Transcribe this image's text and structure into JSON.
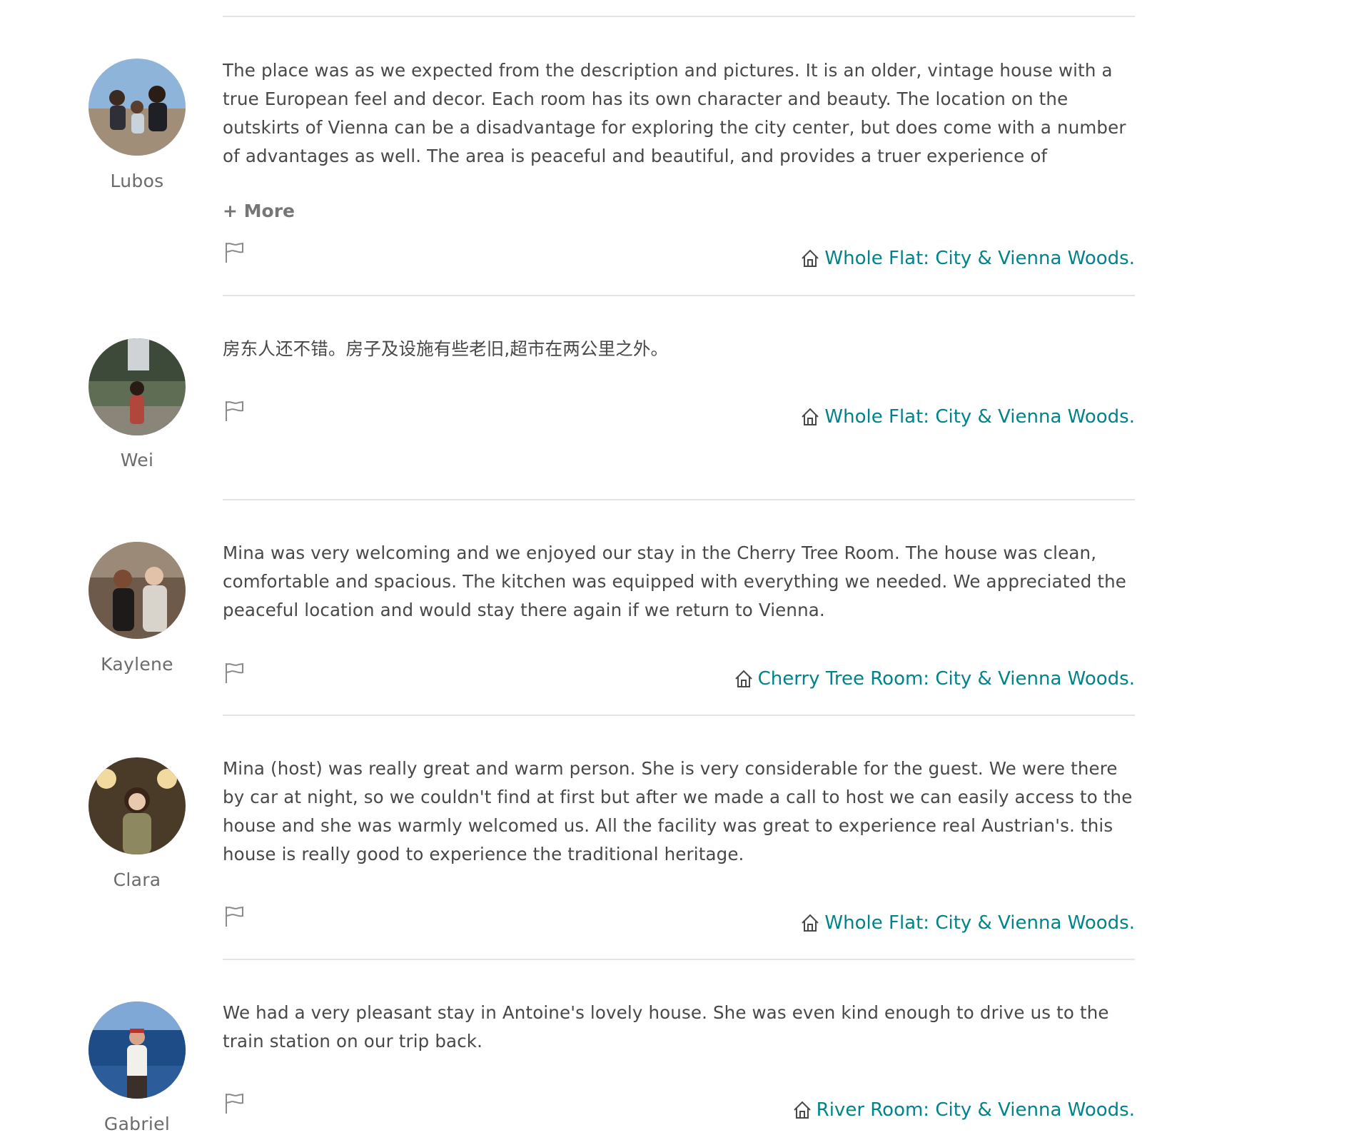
{
  "reviews": [
    {
      "name": "Lubos",
      "text": "The place was as we expected from the description and pictures. It is an older, vintage house with a true European feel and decor. Each room has its own character and beauty. The location on the outskirts of Vienna can be a disadvantage for exploring the city center, but does come with a number of advantages as well. The area is peaceful and beautiful, and provides a truer experience of how/where the locals live. For someone with a car it is great as parking is free right in the front, while",
      "more_label": "+ More",
      "listing": "Whole Flat: City & Vienna Woods."
    },
    {
      "name": "Wei",
      "text": "房东人还不错。房子及设施有些老旧,超市在两公里之外。",
      "listing": "Whole Flat: City & Vienna Woods."
    },
    {
      "name": "Kaylene",
      "text": "Mina was very welcoming and we enjoyed our stay in the Cherry Tree Room. The house was clean, comfortable and spacious. The kitchen was equipped with everything we needed. We appreciated the peaceful location and would stay there again if we return to Vienna.",
      "listing": "Cherry Tree Room: City & Vienna Woods."
    },
    {
      "name": "Clara",
      "text": "Mina (host) was really great and warm person. She is very considerable for the guest. We were there by car at night, so we couldn't find at first but after we made a call to host we can easily access to the house and she was warmly welcomed us. All the facility was great to experience real Austrian's. this house is really good to experience the traditional heritage.",
      "listing": "Whole Flat: City & Vienna Woods."
    },
    {
      "name": "Gabriel",
      "text": "We had a very pleasant stay in Antoine's lovely house. She was even kind enough to drive us to the train station on our trip back.",
      "listing": "River Room: City & Vienna Woods."
    }
  ],
  "colors": {
    "text": "#484848",
    "muted": "#767676",
    "link": "#008489",
    "divider": "#e4e4e4"
  },
  "icons": {
    "flag": "flag-icon",
    "listing": "home-icon"
  }
}
